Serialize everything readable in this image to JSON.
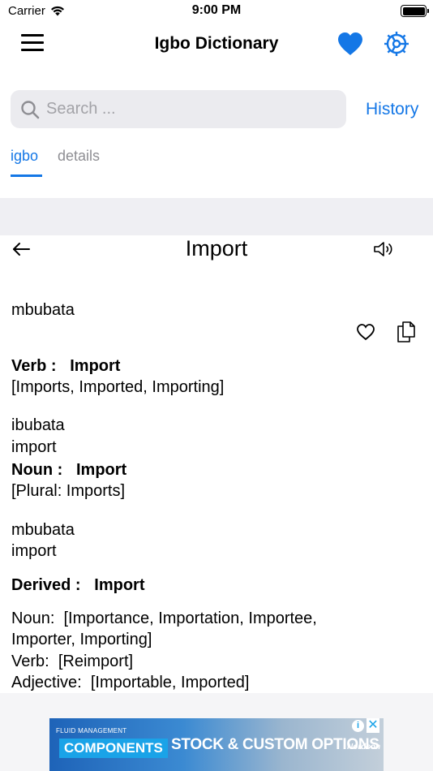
{
  "status_bar": {
    "carrier": "Carrier",
    "time": "9:00 PM"
  },
  "header": {
    "title": "Igbo Dictionary",
    "menu_icon": "hamburger-menu-icon",
    "favorites_icon": "heart-filled-icon",
    "settings_icon": "gear-icon"
  },
  "search": {
    "placeholder": "Search ...",
    "value": "",
    "history_label": "History"
  },
  "tabs": [
    {
      "label": "igbo",
      "active": true
    },
    {
      "label": "details",
      "active": false
    }
  ],
  "entry": {
    "word": "Import",
    "blocks": [
      {
        "igbo": "mbubata"
      },
      {
        "pos_label": "Verb :",
        "pos_word": "Import",
        "forms": "[Imports, Imported, Importing]"
      },
      {
        "igbo": "ibubata",
        "english": "import"
      },
      {
        "pos_label": "Noun :",
        "pos_word": "Import",
        "forms": "[Plural: Imports]"
      },
      {
        "igbo": "mbubata",
        "english": "import"
      }
    ],
    "derived": {
      "label": "Derived :",
      "word": "Import",
      "noun_label": "Noun:",
      "noun_values_line1": "[Importance, Importation, Importee,",
      "noun_values_line2": "Importer, Importing]",
      "verb_label": "Verb:",
      "verb_values": "[Reimport]",
      "adjective_label": "Adjective:",
      "adjective_values": "[Importable, Imported]"
    }
  },
  "ad": {
    "top_text": "FLUID MANAGEMENT",
    "pill_text": "COMPONENTS",
    "headline": "STOCK & CUSTOM OPTIONS",
    "logo_text": "Nordson"
  },
  "colors": {
    "accent": "#1477e6",
    "search_bg": "#ebebef",
    "band_bg": "#efeff3"
  }
}
